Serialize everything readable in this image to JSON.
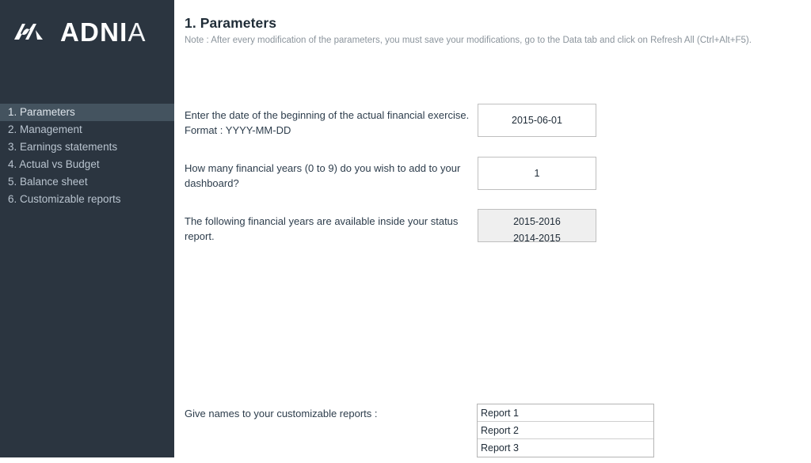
{
  "sidebar": {
    "logo": {
      "mark_icon": "adnia-monogram-icon",
      "text_bold": "ADNI",
      "text_light": "A"
    },
    "items": [
      {
        "label": "1. Parameters",
        "active": true
      },
      {
        "label": "2. Management",
        "active": false
      },
      {
        "label": "3. Earnings statements",
        "active": false
      },
      {
        "label": "4. Actual vs Budget",
        "active": false
      },
      {
        "label": "5. Balance sheet",
        "active": false
      },
      {
        "label": "6. Customizable reports",
        "active": false
      }
    ],
    "background_color": "#2b3540",
    "active_color": "#44535f"
  },
  "header": {
    "title": "1. Parameters",
    "note": "Note : After every modification of the parameters, you must save your modifications, go to the Data tab and click on Refresh All (Ctrl+Alt+F5)."
  },
  "form": {
    "date_row": {
      "label_line1": "Enter the date of the beginning of the actual financial exercise.",
      "label_line2": "Format : YYYY-MM-DD",
      "value": "2015-06-01"
    },
    "years_count_row": {
      "label_line1": "How many financial years (0 to 9) do you wish to add to your",
      "label_line2": "dashboard?",
      "value": "1"
    },
    "years_list_row": {
      "label_line1": "The following financial years are available inside your status",
      "label_line2": "report.",
      "values": [
        "2015-2016",
        "2014-2015"
      ]
    },
    "reports_row": {
      "label": "Give names to your customizable reports :",
      "values": [
        "Report 1",
        "Report 2",
        "Report 3"
      ]
    }
  }
}
